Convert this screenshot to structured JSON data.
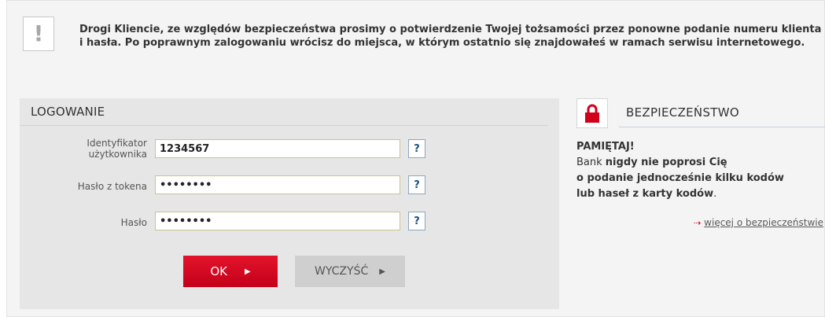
{
  "notice": {
    "icon": "exclamation-icon",
    "text": "Drogi Kliencie, ze względów bezpieczeństwa prosimy o potwierdzenie Twojej tożsamości przez ponowne podanie numeru klienta i hasła. Po poprawnym zalogowaniu wrócisz do miejsca, w którym ostatnio się znajdowałeś w ramach serwisu internetowego."
  },
  "login": {
    "title": "LOGOWANIE",
    "fields": [
      {
        "label_line1": "Identyfikator",
        "label_line2": "użytkownika",
        "value": "1234567",
        "type": "text",
        "help": "?"
      },
      {
        "label": "Hasło z tokena",
        "value": "12345678",
        "type": "password",
        "help": "?"
      },
      {
        "label": "Hasło",
        "value": "12345678",
        "type": "password",
        "help": "?"
      }
    ],
    "ok_label": "OK",
    "clear_label": "WYCZYŚĆ"
  },
  "security": {
    "icon": "lock-icon",
    "title": "BEZPIECZEŃSTWO",
    "remember": "PAMIĘTAJ!",
    "line1_prefix": "Bank ",
    "line1_bold": "nigdy nie poprosi Cię",
    "line2_bold": "o podanie jednocześnie kilku kodów",
    "line3_bold": "lub haseł z karty kodów",
    "line3_suffix": ".",
    "link": "więcej o bezpieczeństwie"
  },
  "colors": {
    "accent_red": "#d0011b",
    "help_blue": "#1d4f80"
  }
}
